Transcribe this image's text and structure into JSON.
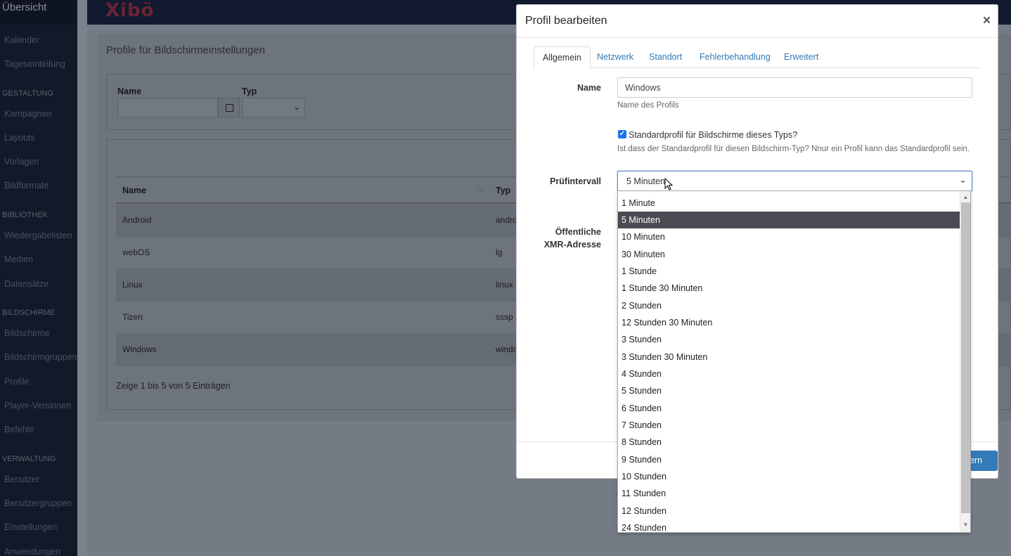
{
  "sidebar": {
    "top_label": "Übersicht",
    "items": [
      {
        "label": "Kalender"
      },
      {
        "label": "Tageseinteilung"
      },
      {
        "label": "GESTALTUNG"
      },
      {
        "label": "Kampagnen"
      },
      {
        "label": "Layouts"
      },
      {
        "label": "Vorlagen"
      },
      {
        "label": "Bildformate"
      },
      {
        "label": "BIBLIOTHEK"
      },
      {
        "label": "Wiedergabelisten"
      },
      {
        "label": "Medien"
      },
      {
        "label": "Datensätze"
      },
      {
        "label": "BILDSCHIRME"
      },
      {
        "label": "Bildschirme"
      },
      {
        "label": "Bildschirmgruppen"
      },
      {
        "label": "Profile"
      },
      {
        "label": "Player-Versionen"
      },
      {
        "label": "Befehle"
      },
      {
        "label": "VERWALTUNG"
      },
      {
        "label": "Benutzer"
      },
      {
        "label": "Benutzergruppen"
      },
      {
        "label": "Einstellungen"
      },
      {
        "label": "Anwendungen"
      }
    ]
  },
  "header": {
    "logo": "Xibö"
  },
  "page": {
    "title": "Profile für Bildschirmeinstellungen",
    "filter": {
      "name_label": "Name",
      "type_label": "Typ"
    },
    "table": {
      "col_name": "Name",
      "col_type": "Typ",
      "rows": [
        {
          "name": "Android",
          "type": "andro"
        },
        {
          "name": "webOS",
          "type": "lg"
        },
        {
          "name": "Linux",
          "type": "linux"
        },
        {
          "name": "Tizen",
          "type": "sssp"
        },
        {
          "name": "Windows",
          "type": "windo"
        }
      ],
      "info": "Zeige 1 bis 5 von 5 Einträgen"
    }
  },
  "modal": {
    "title": "Profil bearbeiten",
    "close": "×",
    "tabs": [
      "Allgemein",
      "Netzwerk",
      "Standort",
      "Fehlerbehandlung",
      "Erweitert"
    ],
    "name_label": "Name",
    "name_value": "Windows",
    "name_help": "Name des Profils",
    "default_label": "Standardprofil für Bildschirme dieses Typs?",
    "default_checked": true,
    "default_help": "Ist dass der Standardprofil für diesen Bildschirm-Typ? Nnur ein Profil kann das Standardprofil sein.",
    "interval_label": "Prüfintervall",
    "interval_value": "5 Minuten",
    "xmr_label_1": "Öffentliche",
    "xmr_label_2": "XMR-Adresse",
    "save_label": "ern"
  },
  "dropdown": {
    "selected_index": 1,
    "options": [
      "1 Minute",
      "5 Minuten",
      "10 Minuten",
      "30 Minuten",
      "1 Stunde",
      "1 Stunde 30 Minuten",
      "2 Stunden",
      "12 Stunden 30 Minuten",
      "3 Stunden",
      "3 Stunden 30 Minuten",
      "4 Stunden",
      "5 Stunden",
      "6 Stunden",
      "7 Stunden",
      "8 Stunden",
      "9 Stunden",
      "10 Stunden",
      "11 Stunden",
      "12 Stunden",
      "24 Stunden"
    ]
  },
  "colors": {
    "accent": "#337ab7",
    "checkbox": "#1a73e8",
    "selected_option": "#4a4a52",
    "sidebar_bg": "#14192a",
    "logo": "#6b2334"
  }
}
